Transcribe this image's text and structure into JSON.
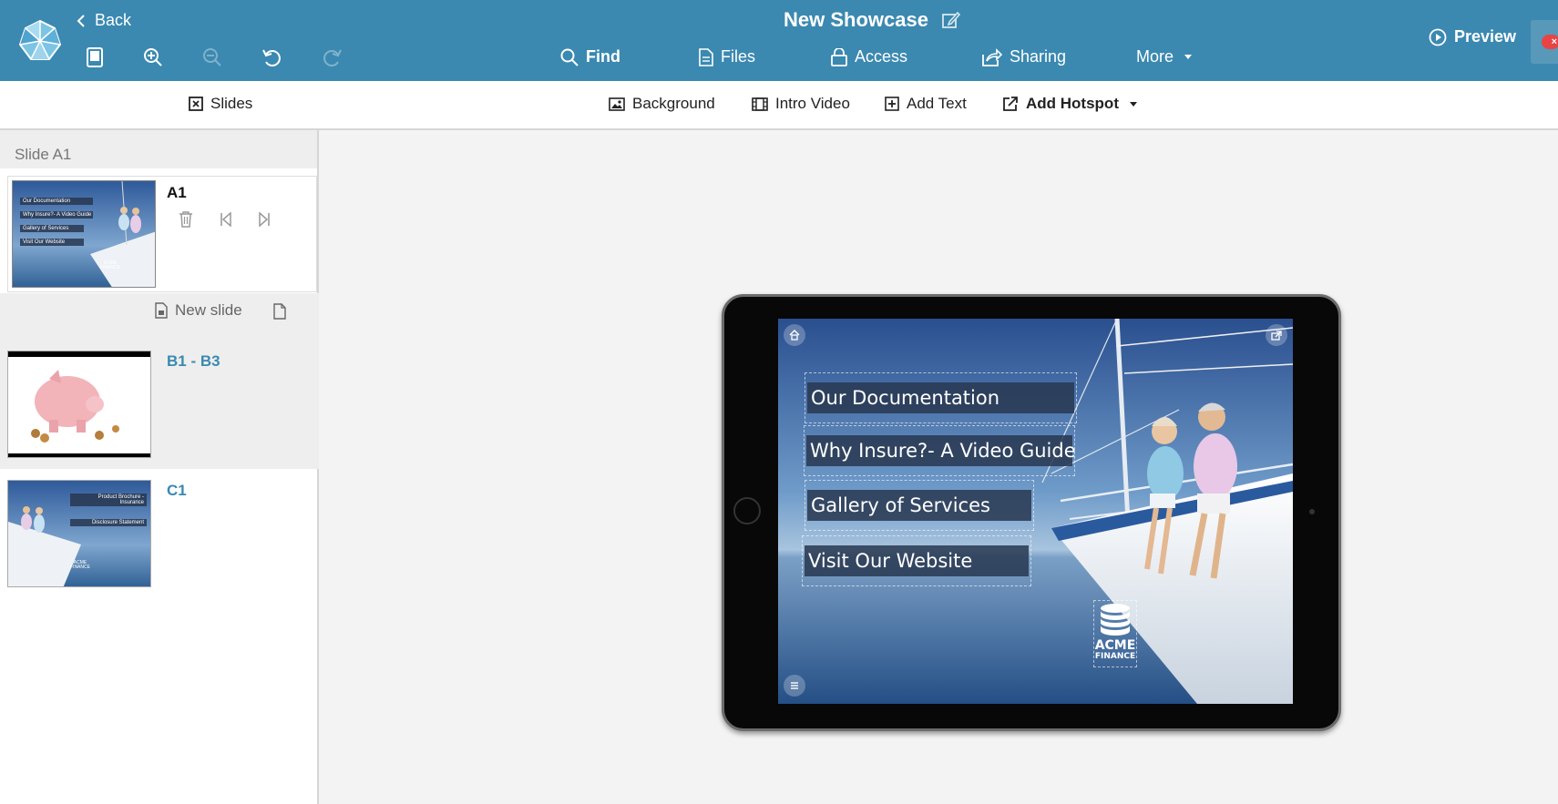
{
  "header": {
    "back_label": "Back",
    "title": "New Showcase",
    "nav": {
      "find": "Find",
      "files": "Files",
      "access": "Access",
      "sharing": "Sharing",
      "more": "More"
    },
    "preview_label": "Preview",
    "close_label": "×"
  },
  "subtoolbar": {
    "slides": "Slides",
    "background": "Background",
    "intro_video": "Intro Video",
    "add_text": "Add Text",
    "add_hotspot": "Add Hotspot"
  },
  "sidebar": {
    "section_title": "Slide A1",
    "new_slide_label": "New slide",
    "slides": [
      {
        "label": "A1",
        "thumb_buttons": [
          "Our Documentation",
          "Why Insure?- A Video Guide",
          "Gallery of Services",
          "Visit Our Website"
        ],
        "thumb_logo": [
          "ACME",
          "FINANCE"
        ]
      },
      {
        "label": "B1 - B3"
      },
      {
        "label": "C1",
        "thumb_buttons": [
          "Product Brochure - Insurance",
          "Disclosure Statement"
        ],
        "thumb_logo": [
          "ACME",
          "FINANCE"
        ]
      }
    ]
  },
  "canvas": {
    "hotspots": [
      "Our Documentation",
      "Why Insure?- A Video Guide",
      "Gallery of Services",
      "Visit Our Website"
    ],
    "logo": {
      "line1": "ACME",
      "line2": "FINANCE"
    }
  },
  "colors": {
    "header_bg": "#3b89b0",
    "slide_link": "#3b89b0",
    "hotspot_bg": "#28374f"
  }
}
